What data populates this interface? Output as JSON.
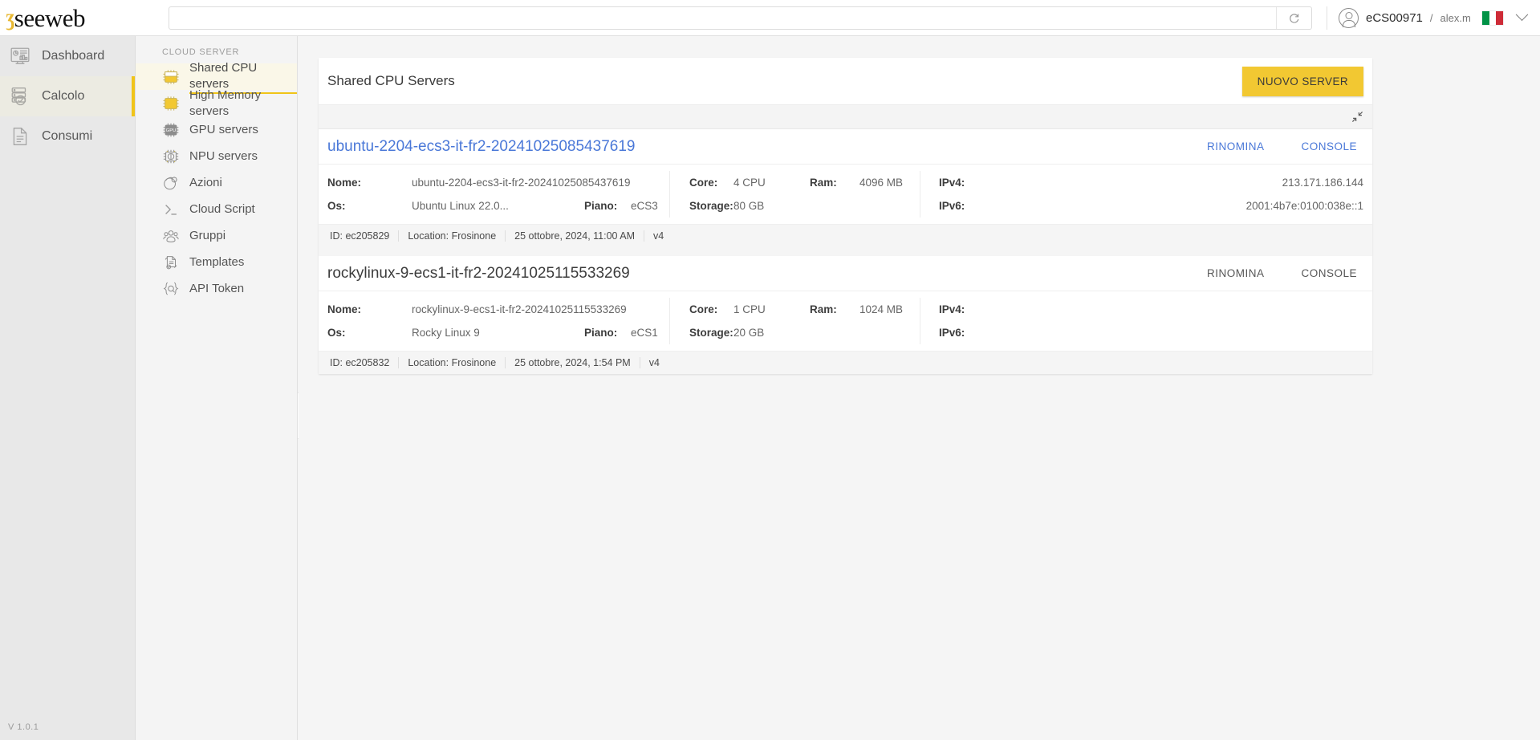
{
  "brand": {
    "mark": "ʒ",
    "word": "seeweb"
  },
  "search": {
    "value": "",
    "placeholder": "",
    "refresh_icon": "refresh-icon"
  },
  "account": {
    "name": "eCS00971",
    "separator": "/",
    "user": "alex.m",
    "flag": "italian-flag",
    "caret": "chevron-down-icon"
  },
  "primary_nav": {
    "items": [
      {
        "label": "Dashboard",
        "icon": "dashboard-icon",
        "active": false
      },
      {
        "label": "Calcolo",
        "icon": "server-stack-icon",
        "active": true
      },
      {
        "label": "Consumi",
        "icon": "document-icon",
        "active": false
      }
    ],
    "version": "V 1.0.1"
  },
  "secondary_nav": {
    "title": "CLOUD SERVER",
    "items": [
      {
        "label": "Shared CPU servers",
        "icon": "cpu-chip-icon",
        "active": true
      },
      {
        "label": "High Memory servers",
        "icon": "memory-chip-icon",
        "active": false
      },
      {
        "label": "GPU servers",
        "icon": "gpu-chip-icon",
        "active": false
      },
      {
        "label": "NPU servers",
        "icon": "npu-chip-icon",
        "active": false
      },
      {
        "label": "Azioni",
        "icon": "actions-gear-icon",
        "active": false
      },
      {
        "label": "Cloud Script",
        "icon": "terminal-prompt-icon",
        "active": false
      },
      {
        "label": "Gruppi",
        "icon": "users-group-icon",
        "active": false
      },
      {
        "label": "Templates",
        "icon": "templates-icon",
        "active": false
      },
      {
        "label": "API Token",
        "icon": "api-token-icon",
        "active": false
      }
    ],
    "collapse_handle": "collapse-sidebar-icon"
  },
  "panel": {
    "title": "Shared CPU Servers",
    "new_server_label": "NUOVO SERVER",
    "collapse_all_icon": "collapse-all-icon"
  },
  "labels": {
    "nome": "Nome:",
    "os": "Os:",
    "piano": "Piano:",
    "core": "Core:",
    "storage": "Storage:",
    "ram": "Ram:",
    "ipv4": "IPv4:",
    "ipv6": "IPv6:",
    "rinomina": "RINOMINA",
    "console": "CONSOLE"
  },
  "servers": [
    {
      "title": "ubuntu-2204-ecs3-it-fr2-20241025085437619",
      "title_is_link": true,
      "nome": "ubuntu-2204-ecs3-it-fr2-20241025085437619",
      "os": "Ubuntu Linux 22.0...",
      "piano": "eCS3",
      "core": "4 CPU",
      "ram": "4096 MB",
      "storage": "80 GB",
      "ipv4": "213.171.186.144",
      "ipv6": "2001:4b7e:0100:038e::1",
      "id": "ID: ec205829",
      "location": "Location: Frosinone",
      "created": "25 ottobre, 2024, 11:00 AM",
      "version": "v4"
    },
    {
      "title": "rockylinux-9-ecs1-it-fr2-20241025115533269",
      "title_is_link": false,
      "nome": "rockylinux-9-ecs1-it-fr2-20241025115533269",
      "os": "Rocky Linux 9",
      "piano": "eCS1",
      "core": "1 CPU",
      "ram": "1024 MB",
      "storage": "20 GB",
      "ipv4": "",
      "ipv6": "",
      "id": "ID: ec205832",
      "location": "Location: Frosinone",
      "created": "25 ottobre, 2024, 1:54 PM",
      "version": "v4"
    }
  ],
  "colors": {
    "accent_yellow": "#f2c832",
    "link_blue": "#4a78d8",
    "sidebar_grey": "#e8e8e8",
    "flag_green": "#009246",
    "flag_red": "#ce2b37"
  }
}
